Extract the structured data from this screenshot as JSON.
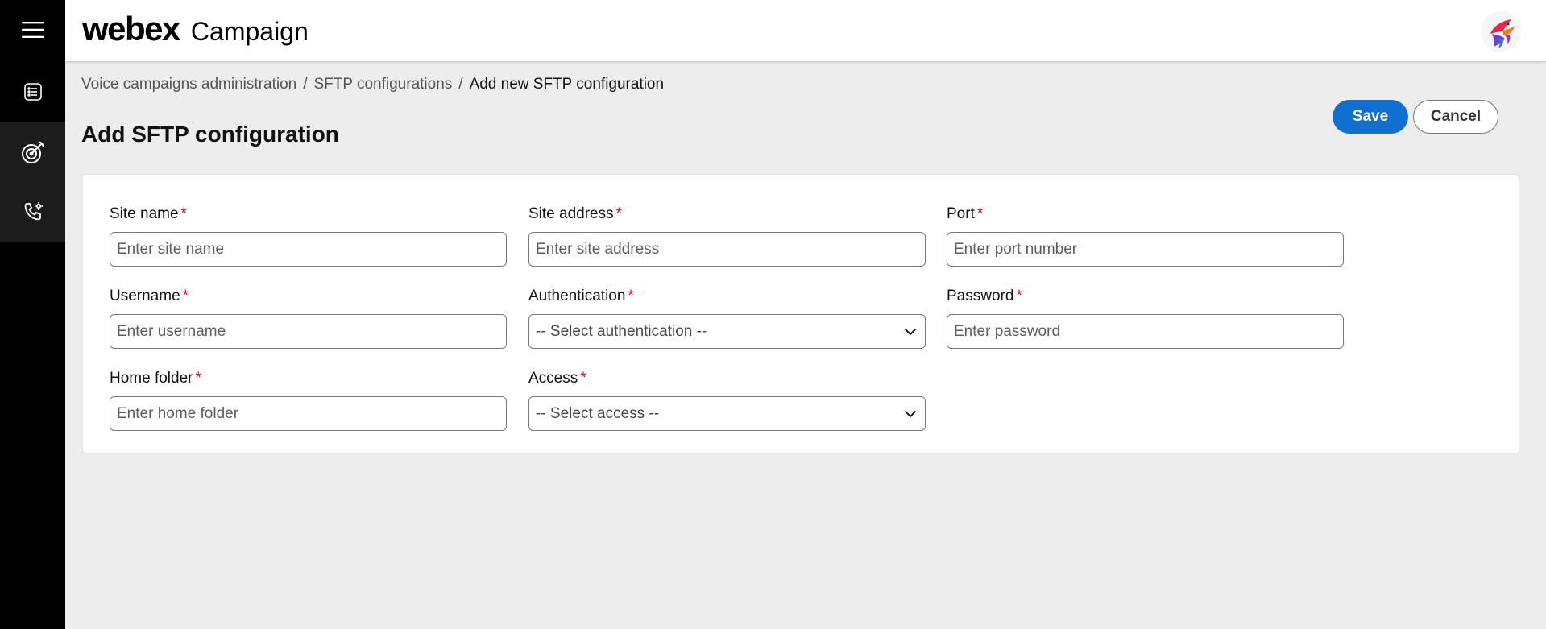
{
  "header": {
    "brand_logo": "webex",
    "product_name": "Campaign"
  },
  "breadcrumb": {
    "items": [
      "Voice campaigns administration",
      "SFTP configurations",
      "Add new SFTP configuration"
    ],
    "separator": "/"
  },
  "page": {
    "title": "Add SFTP configuration"
  },
  "actions": {
    "save_label": "Save",
    "cancel_label": "Cancel"
  },
  "form": {
    "required_marker": "*",
    "fields": {
      "site_name": {
        "label": "Site name",
        "placeholder": "Enter site name",
        "value": ""
      },
      "site_address": {
        "label": "Site address",
        "placeholder": "Enter site address",
        "value": ""
      },
      "port": {
        "label": "Port",
        "placeholder": "Enter port number",
        "value": ""
      },
      "username": {
        "label": "Username",
        "placeholder": "Enter username",
        "value": ""
      },
      "authentication": {
        "label": "Authentication",
        "selected": "-- Select authentication --"
      },
      "password": {
        "label": "Password",
        "placeholder": "Enter password",
        "value": ""
      },
      "home_folder": {
        "label": "Home folder",
        "placeholder": "Enter home folder",
        "value": ""
      },
      "access": {
        "label": "Access",
        "selected": "-- Select access --"
      }
    }
  },
  "rail": {
    "icons": [
      "hamburger-menu-icon",
      "list-document-icon",
      "target-icon",
      "phone-settings-icon"
    ]
  },
  "colors": {
    "primary": "#1170cf",
    "required": "#d6091a",
    "rail_background": "#000000",
    "page_background": "#ededed"
  }
}
